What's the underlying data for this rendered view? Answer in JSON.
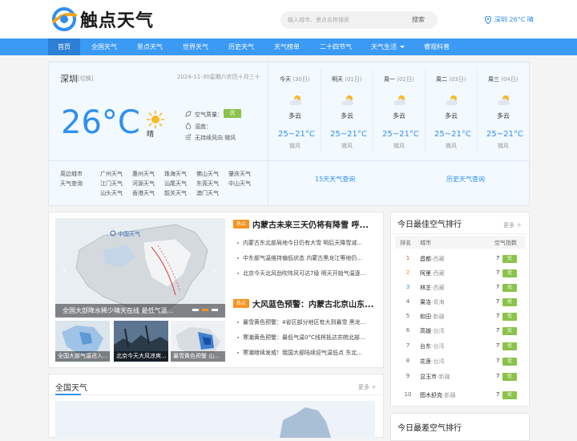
{
  "header": {
    "logo_text": "触点天气",
    "search_placeholder": "输入城市、景点名称搜索",
    "search_button": "搜索",
    "location": "深圳 26°C 晴"
  },
  "nav": [
    "首页",
    "全国天气",
    "景点天气",
    "世界天气",
    "历史天气",
    "天气榜单",
    "二十四节气",
    "天气生活",
    "睿观科普"
  ],
  "current": {
    "city": "深圳",
    "switch": "[切换]",
    "date": "2024-11-30星期六农历十月三十",
    "temp": "26°C",
    "condition": "晴",
    "aqi_label": "空气质量：",
    "aqi_value": "优",
    "humidity_label": "湿度：",
    "wind": "无持续风向 微风"
  },
  "nearby": {
    "label1": "周边城市",
    "label2": "天气查询",
    "cities": [
      "广州天气",
      "惠州天气",
      "珠海天气",
      "佛山天气",
      "肇庆天气",
      "江门天气",
      "河源天气",
      "汕尾天气",
      "东莞天气",
      "中山天气",
      "汕头天气",
      "香港天气",
      "韶关天气",
      "澳门天气"
    ]
  },
  "forecast": [
    {
      "day": "今天",
      "date": "(30日)",
      "cond": "多云",
      "temp": "25~21°C",
      "wind": "微风"
    },
    {
      "day": "明天",
      "date": "(01日)",
      "cond": "多云",
      "temp": "25~21°C",
      "wind": "微风"
    },
    {
      "day": "周一",
      "date": "(02日)",
      "cond": "多云",
      "temp": "25~21°C",
      "wind": "微风"
    },
    {
      "day": "周二",
      "date": "(03日)",
      "cond": "多云",
      "temp": "25~21°C",
      "wind": "微风"
    },
    {
      "day": "周三",
      "date": "(04日)",
      "cond": "多云",
      "temp": "25~21°C",
      "wind": "微风"
    }
  ],
  "links": {
    "fifteen": "15天天气查询",
    "history": "历史天气查询"
  },
  "news": {
    "map_brand": "中国天气",
    "main_caption": "全国大部降水稀少晴天在线 最低气温...",
    "thumbs": [
      "全国大部气温进入...",
      "北京今天大风凉爽...",
      "暴雪黄色预警 山..."
    ],
    "hot_label": "热点",
    "headline1": "内蒙古未来三天仍将有降雪 呼...",
    "items1": [
      "内蒙古东北部局地今日仍有大雪 明后天降雪减...",
      "中东部气温维持偏低状态 内蒙古黑龙江等地仍...",
      "北京今天北风劲吹阵风可达7级 明天开始气温逐..."
    ],
    "headline2": "大风蓝色预警：内蒙古北京山东...",
    "items2": [
      "暴雪黄色预警：4省区部分地区有大到暴雪 黑龙...",
      "寒潮黄色预警：最低气温0°C线将抵达苏皖北部...",
      "寒潮继续发威！我国大部陆续迎气温低点 东北..."
    ]
  },
  "nation": {
    "title": "全国天气",
    "more": "更多"
  },
  "ranking": {
    "title": "今日最佳空气排行",
    "more": "更多",
    "headers": [
      "排名",
      "城市",
      "空气指数"
    ],
    "rows": [
      {
        "rank": "1",
        "city": "昌都",
        "region": "-西藏",
        "value": "7",
        "level": "优"
      },
      {
        "rank": "2",
        "city": "阿里",
        "region": "-西藏",
        "value": "7",
        "level": "优"
      },
      {
        "rank": "3",
        "city": "林芝",
        "region": "-西藏",
        "value": "7",
        "level": "优"
      },
      {
        "rank": "4",
        "city": "果洛",
        "region": "-青海",
        "value": "7",
        "level": "优"
      },
      {
        "rank": "5",
        "city": "和田",
        "region": "-新疆",
        "value": "7",
        "level": "优"
      },
      {
        "rank": "6",
        "city": "高雄",
        "region": "-台湾",
        "value": "7",
        "level": "优"
      },
      {
        "rank": "7",
        "city": "台东",
        "region": "-台湾",
        "value": "7",
        "level": "优"
      },
      {
        "rank": "8",
        "city": "花莲",
        "region": "-台湾",
        "value": "7",
        "level": "优"
      },
      {
        "rank": "9",
        "city": "显玉市",
        "region": "-新疆",
        "value": "7",
        "level": "优"
      },
      {
        "rank": "10",
        "city": "图木舒克",
        "region": "-新疆",
        "value": "7",
        "level": "优"
      }
    ],
    "title2": "今日最差空气排行"
  }
}
